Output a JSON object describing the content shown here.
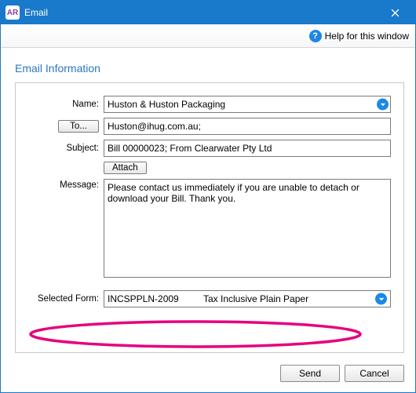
{
  "window": {
    "app_badge": "AR",
    "title": "Email"
  },
  "toolbar": {
    "help_label": "Help for this window"
  },
  "section_title": "Email Information",
  "labels": {
    "name": "Name:",
    "to_button": "To...",
    "subject": "Subject:",
    "attach_button": "Attach",
    "message": "Message:",
    "selected_form": "Selected Form:"
  },
  "fields": {
    "name": "Huston & Huston Packaging",
    "to": "Huston@ihug.com.au;",
    "subject": "Bill 00000023; From Clearwater Pty Ltd",
    "message": "Please contact us immediately if you are unable to detach or download your Bill. Thank you.",
    "selected_form_code": "INCSPPLN-2009",
    "selected_form_desc": "Tax Inclusive Plain Paper"
  },
  "buttons": {
    "send": "Send",
    "cancel": "Cancel"
  }
}
